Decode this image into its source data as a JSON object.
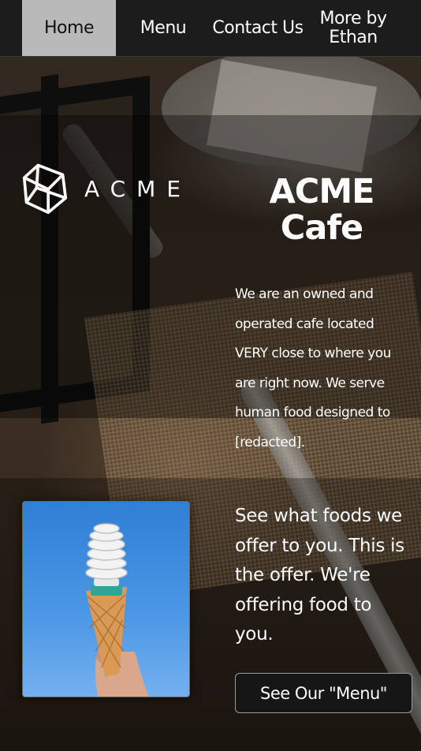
{
  "nav": {
    "items": [
      {
        "label": "Home",
        "active": true
      },
      {
        "label": "Menu",
        "active": false
      },
      {
        "label": "Contact Us",
        "active": false
      },
      {
        "label": "More by Ethan",
        "active": false
      }
    ]
  },
  "hero": {
    "logo_text": "ACME",
    "logo_icon": "cube-icon",
    "title": "ACME Cafe",
    "description": "We are an owned and operated cafe located VERY close to where you are right now. We serve human food designed to [redacted]."
  },
  "offer": {
    "text": "See what foods we offer to you. This is the offer. We're offering food to you.",
    "button_label": "See Our \"Menu\"",
    "image_subject": "hand-holding-lightbulb-in-ice-cream-cone"
  },
  "colors": {
    "nav_bg": "#1c1c1c",
    "nav_active_bg": "#b9b9b9",
    "button_bg": "#161616",
    "text": "#ffffff"
  }
}
